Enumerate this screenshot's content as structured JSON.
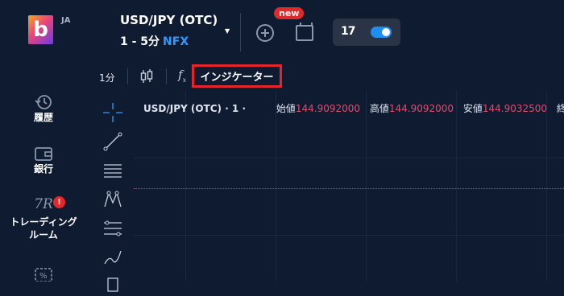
{
  "header": {
    "logo_letter": "b",
    "lang": "JA",
    "pair": "USD/JPY (OTC)",
    "timeframe": "1 - 5分",
    "broker": "NFX",
    "new_badge": "new",
    "tv_logo": "17"
  },
  "toolbar": {
    "interval": "1分",
    "indicators_label": "インジケーター"
  },
  "sidebar": {
    "items": [
      {
        "label": "履歴",
        "icon": "history-icon"
      },
      {
        "label": "銀行",
        "icon": "wallet-icon"
      },
      {
        "label": "トレーディング",
        "label2": "ルーム",
        "icon": "trading-room-icon",
        "badge": "!"
      },
      {
        "label": "",
        "icon": "promo-icon"
      }
    ]
  },
  "chart_legend": {
    "symbol": "USD/JPY (OTC) · 1 ·",
    "open_label": "始値",
    "open_value": "144.9092000",
    "high_label": "高値",
    "high_value": "144.9092000",
    "low_label": "安値",
    "low_value": "144.9032500",
    "close_label_partial": "終"
  },
  "colors": {
    "background": "#0f1b31",
    "accent": "#2e9bff",
    "highlight_border": "#e3262e",
    "price_value": "#e24b6c"
  }
}
